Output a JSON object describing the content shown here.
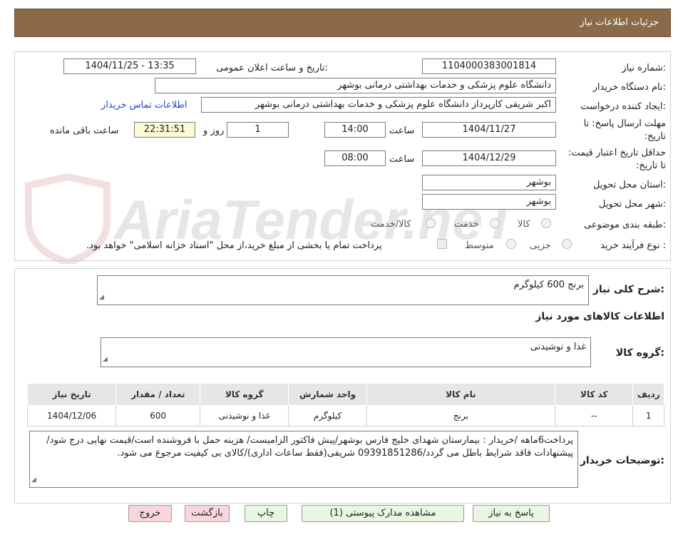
{
  "header": {
    "title": "جزئیات اطلاعات نیاز"
  },
  "watermark": {
    "text": "AriaTender.neT"
  },
  "form": {
    "need_number_label": "شماره نیاز:",
    "need_number": "1104000383001814",
    "announce_label": "تاریخ و ساعت اعلان عمومی:",
    "announce_value": "1404/11/25 - 13:35",
    "buyer_org_label": "نام دستگاه خریدار:",
    "buyer_org": "دانشگاه علوم پزشکی و خدمات بهداشتی درمانی بوشهر",
    "creator_label": "ایجاد کننده درخواست:",
    "creator": "اکبر شریفی کارپرداز دانشگاه علوم پزشکی و خدمات بهداشتی درمانی بوشهر",
    "contact_link": "اطلاعات تماس خریدار",
    "deadline_label": "مهلت ارسال پاسخ: تا تاریخ:",
    "deadline_date": "1404/11/27",
    "time_label": "ساعت",
    "deadline_time": "14:00",
    "days_value": "1",
    "days_label": "روز و",
    "remaining_time": "22:31:51",
    "remaining_label": "ساعت باقی مانده",
    "validity_label": "حداقل تاریخ اعتبار قیمت: تا تاریخ:",
    "validity_date": "1404/12/29",
    "validity_time": "08:00",
    "province_label": "استان محل تحویل:",
    "province": "بوشهر",
    "city_label": "شهر محل تحویل:",
    "city": "بوشهر",
    "category_label": "طبقه بندی موضوعی:",
    "category_options": [
      "کالا",
      "خدمت",
      "کالا/خدمت"
    ],
    "process_label": "نوع فرآیند خرید :",
    "process_options": [
      "جزیی",
      "متوسط"
    ],
    "payment_note": "پرداخت تمام یا بخشی از مبلغ خرید،از محل \"اسناد خزانه اسلامی\" خواهد بود."
  },
  "summary": {
    "desc_label": "شرح کلی نیاز:",
    "desc_value": "برنج 600 کیلوگرم",
    "items_title": "اطلاعات کالاهای مورد نیاز",
    "group_label": "گروه کالا:",
    "group_value": "غذا و نوشیدنی",
    "table": {
      "headers": [
        "ردیف",
        "کد کالا",
        "نام کالا",
        "واحد شمارش",
        "گروه کالا",
        "تعداد / مقدار",
        "تاریخ نیاز"
      ],
      "rows": [
        [
          "1",
          "--",
          "برنج",
          "کیلوگرم",
          "غذا و نوشیدنی",
          "600",
          "1404/12/06"
        ]
      ]
    },
    "buyer_notes_label": "توضیحات خریدار:",
    "buyer_notes": "پرداخت6ماهه /خریدار : بیمارستان شهدای خلیج فارس بوشهر/پیش فاکتور الزامیست/ هزینه حمل با فروشنده است/قیمت نهایی درج شود/پیشنهادات فاقد شرایط باطل می گردد/09391851286 شریفی(فقط ساعات اداری)/کالای بی کیفیت مرجوع می شود."
  },
  "buttons": {
    "reply": "پاسخ به نیاز",
    "attachments": "مشاهده مدارک پیوستی (1)",
    "print": "چاپ",
    "back": "بازگشت",
    "exit": "خروج"
  },
  "colors": {
    "header": "#8a6a48",
    "button_green": "#e9f6e2",
    "button_pink": "#f8d7dc",
    "link": "#1a4dc9"
  }
}
